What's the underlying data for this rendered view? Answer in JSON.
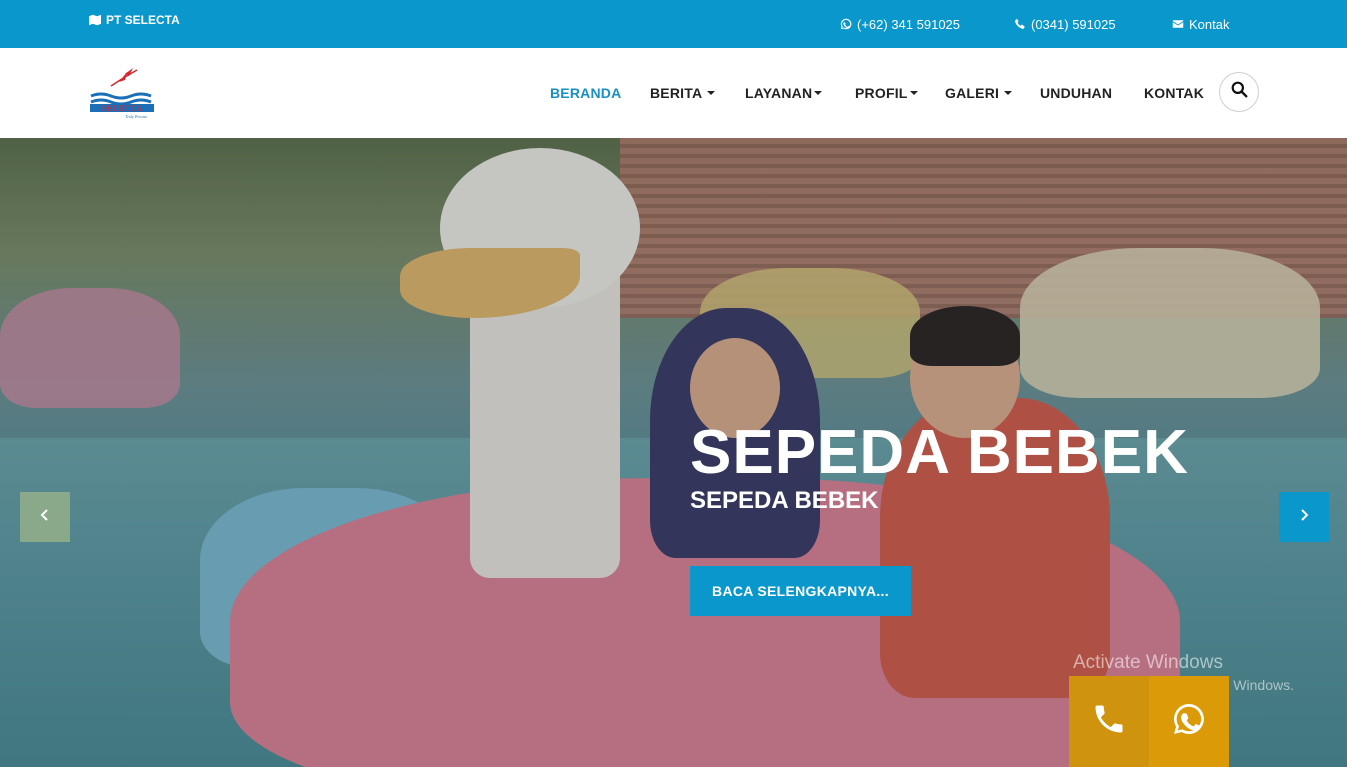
{
  "topbar": {
    "brand": "PT SELECTA",
    "whatsapp": "(+62) 341 591025",
    "phone": "(0341) 591025",
    "contact": "Kontak",
    "bg_color": "#0a97cc"
  },
  "nav": {
    "items": [
      {
        "label": "BERANDA",
        "active": true
      },
      {
        "label": "BERITA",
        "dropdown": true
      },
      {
        "label": "LAYANAN",
        "dropdown": true
      },
      {
        "label": "PROFIL",
        "dropdown": true
      },
      {
        "label": "GALERI",
        "dropdown": true
      },
      {
        "label": "UNDUHAN"
      },
      {
        "label": "KONTAK"
      }
    ],
    "search_icon": "search-icon",
    "active_color": "#1a8fc4"
  },
  "logo": {
    "text": "SELECTA",
    "tagline": "Truly Pesona"
  },
  "hero": {
    "title": "SEPEDA BEBEK",
    "subtitle": "SEPEDA BEBEK",
    "cta": "BACA SELENGKAPNYA..."
  },
  "watermark": {
    "line1": "Activate Windows",
    "line2": "Go to Settings to activate Windows."
  },
  "floating": {
    "call_icon": "phone-icon",
    "whatsapp_icon": "whatsapp-icon",
    "color": "#d89a0c"
  }
}
